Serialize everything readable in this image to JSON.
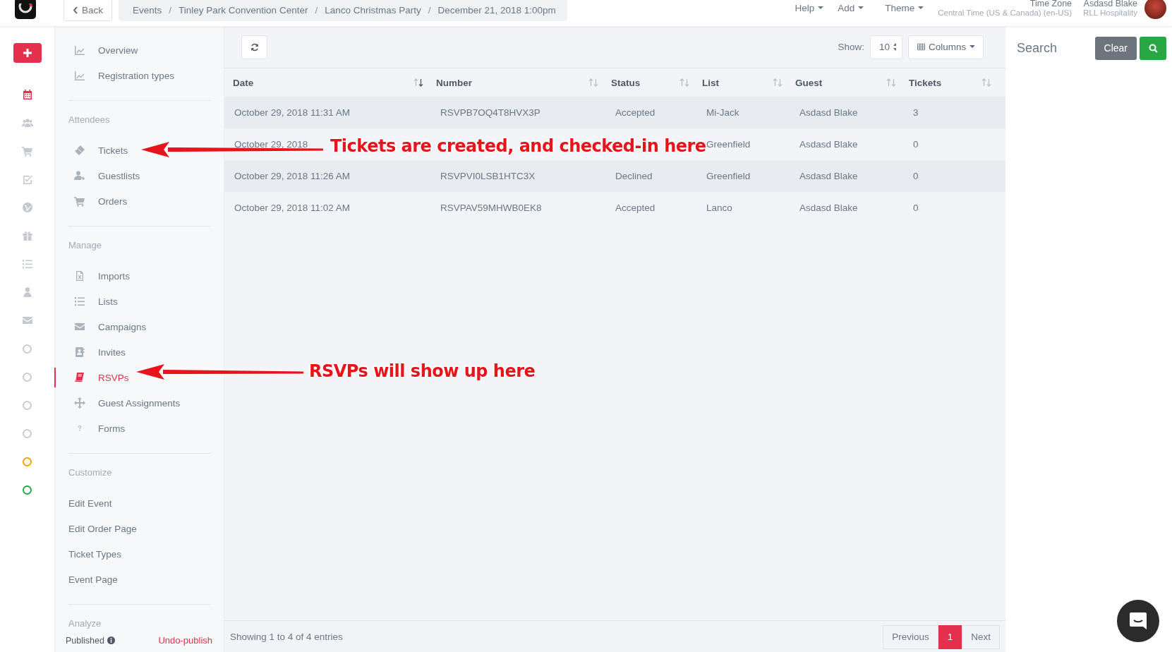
{
  "topbar": {
    "back": "Back",
    "separator": "/",
    "breadcrumbs": [
      "Events",
      "Tinley Park Convention Center",
      "Lanco Christmas Party",
      "December 21, 2018 1:00pm"
    ],
    "menus": [
      "Help",
      "Add",
      "Theme"
    ],
    "timezone": {
      "label": "Time Zone",
      "value": "Central Time (US & Canada) (en-US)"
    },
    "user": {
      "name": "Asdasd Blake",
      "org": "RLL Hospitality"
    }
  },
  "rail": [
    {
      "selected": true
    },
    {
      "selected": false
    },
    {
      "selected": false
    },
    {
      "selected": false
    },
    {
      "selected": false
    },
    {
      "selected": false
    },
    {
      "selected": false
    },
    {
      "selected": false
    },
    {
      "selected": false
    }
  ],
  "rail_status": [
    {
      "color": "#c8ccd0"
    },
    {
      "color": "#c8ccd0"
    },
    {
      "color": "#c8ccd0"
    },
    {
      "color": "#c8ccd0"
    },
    {
      "color": "#f0a500"
    },
    {
      "color": "#28a745"
    }
  ],
  "sidebar": {
    "sections": [
      {
        "items": [
          {
            "label": "Overview",
            "selected": false
          },
          {
            "label": "Registration types",
            "selected": false
          }
        ]
      },
      {
        "heading": "Attendees",
        "items": [
          {
            "label": "Tickets",
            "selected": false
          },
          {
            "label": "Guestlists",
            "selected": false
          },
          {
            "label": "Orders",
            "selected": false
          }
        ]
      },
      {
        "heading": "Manage",
        "items": [
          {
            "label": "Imports",
            "selected": false
          },
          {
            "label": "Lists",
            "selected": false
          },
          {
            "label": "Campaigns",
            "selected": false
          },
          {
            "label": "Invites",
            "selected": false
          },
          {
            "label": "RSVPs",
            "selected": true
          },
          {
            "label": "Guest Assignments",
            "selected": false
          },
          {
            "label": "Forms",
            "selected": false
          }
        ]
      },
      {
        "heading": "Customize",
        "items": [
          {
            "label": "Edit Event",
            "selected": false
          },
          {
            "label": "Edit Order Page",
            "selected": false
          },
          {
            "label": "Ticket Types",
            "selected": false
          },
          {
            "label": "Event Page",
            "selected": false
          }
        ]
      },
      {
        "heading": "Analyze"
      }
    ],
    "status": "Published",
    "undo": "Undo-publish"
  },
  "toolbar": {
    "show_label": "Show:",
    "page_size": "10",
    "columns_button": "Columns"
  },
  "table": {
    "columns": [
      {
        "label": "Date",
        "sorted": true
      },
      {
        "label": "Number",
        "sorted": false
      },
      {
        "label": "Status",
        "sorted": false
      },
      {
        "label": "List",
        "sorted": false
      },
      {
        "label": "Guest",
        "sorted": false
      },
      {
        "label": "Tickets",
        "sorted": false
      }
    ],
    "rows": [
      {
        "cells": [
          "October 29, 2018 11:31 AM",
          "RSVPB7OQ4T8HVX3P",
          "Accepted",
          "Mi-Jack",
          "Asdasd Blake",
          "3"
        ]
      },
      {
        "cells": [
          "October 29, 2018",
          null,
          null,
          "Greenfield",
          "Asdasd Blake",
          "0"
        ]
      },
      {
        "cells": [
          "October 29, 2018 11:26 AM",
          "RSVPVI0LSB1HTC3X",
          "Declined",
          "Greenfield",
          "Asdasd Blake",
          "0"
        ]
      },
      {
        "cells": [
          "October 29, 2018 11:02 AM",
          "RSVPAV59MHWB0EK8",
          "Accepted",
          "Lanco",
          "Asdasd Blake",
          "0"
        ]
      }
    ]
  },
  "footer": {
    "info": "Showing 1 to 4 of 4 entries",
    "pages": [
      {
        "label": "Previous",
        "selected": false
      },
      {
        "label": "1",
        "selected": true
      },
      {
        "label": "Next",
        "selected": false
      }
    ]
  },
  "search_panel": {
    "title": "Search",
    "clear": "Clear"
  },
  "annotations": [
    {
      "text": "Tickets are created, and checked-in here"
    },
    {
      "text": "RSVPs will show up here"
    }
  ]
}
